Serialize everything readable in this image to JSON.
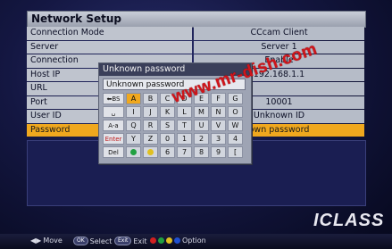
{
  "window": {
    "title": "Network Setup"
  },
  "menu": {
    "rows": [
      {
        "label": "Connection Mode",
        "value": "CCcam Client"
      },
      {
        "label": "Server",
        "value": "Server 1"
      },
      {
        "label": "Connection",
        "value": "Enable"
      },
      {
        "label": "Host IP",
        "value": "192.168.1.1"
      },
      {
        "label": "URL",
        "value": ""
      },
      {
        "label": "Port",
        "value": "10001"
      },
      {
        "label": "User ID",
        "value": "Unknown ID"
      },
      {
        "label": "Password",
        "value": "own password"
      }
    ],
    "selected_row": "Password"
  },
  "keyboard": {
    "title": "Unknown password",
    "input_value": "Unknown password",
    "rows": [
      [
        "BS",
        "A",
        "B",
        "C",
        "D",
        "E",
        "F",
        "G",
        "H"
      ],
      [
        "␣",
        "I",
        "J",
        "K",
        "L",
        "M",
        "N",
        "O",
        "P"
      ],
      [
        "A-a",
        "Q",
        "R",
        "S",
        "T",
        "U",
        "V",
        "W",
        "X"
      ],
      [
        "Enter",
        "Y",
        "Z",
        "0",
        "1",
        "2",
        "3",
        "4",
        "5"
      ],
      [
        "Del",
        "",
        "",
        "6",
        "7",
        "8",
        "9",
        "[",
        "]"
      ]
    ],
    "active_key": "A"
  },
  "watermark": "www.mr-dish.com",
  "logo": "ICLASS",
  "status_bar": {
    "move_label": "Move",
    "ok_key": "OK",
    "select_label": "Select",
    "exit_key": "Exit",
    "exit_label": "Exit",
    "option_label": "Option",
    "colors": {
      "red": "#d02020",
      "green": "#20a040",
      "yellow": "#e0c020",
      "blue": "#2050d0"
    }
  },
  "accent": "#f0a81e"
}
